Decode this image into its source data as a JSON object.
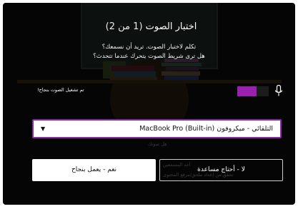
{
  "dialog": {
    "title": "اختبار الصوت",
    "step_count": "(1 من 2)",
    "question_line_1": "تكلم لاختبار الصوت. تريد أن نسمعك؟",
    "question_line_2": "هل ترى شريط الصوت يتحرك عندما تتحدث؟"
  },
  "microphone": {
    "status_text": "تم تشغيل الصوت بنجاح!",
    "level_fraction": 0.62,
    "icon": "microphone-icon"
  },
  "device_select": {
    "selected_value": "التلقائي - ميكروفون MacBook Pro (Built-in)"
  },
  "background": {
    "obscured_hint": "هل صوتك"
  },
  "buttons": {
    "yes_label": "نعم - يعمل بنجاح",
    "no_label": "لا - أحتاج مساعدة",
    "no_ghost_line_1": "أحد المسمعين",
    "no_ghost_line_2": "تحقق من إعداد ملحق/مرفع المحتوى"
  },
  "colors": {
    "dialog_background": "#050505",
    "accent": "#9b1fb0",
    "select_border": "#8a2ba5"
  }
}
